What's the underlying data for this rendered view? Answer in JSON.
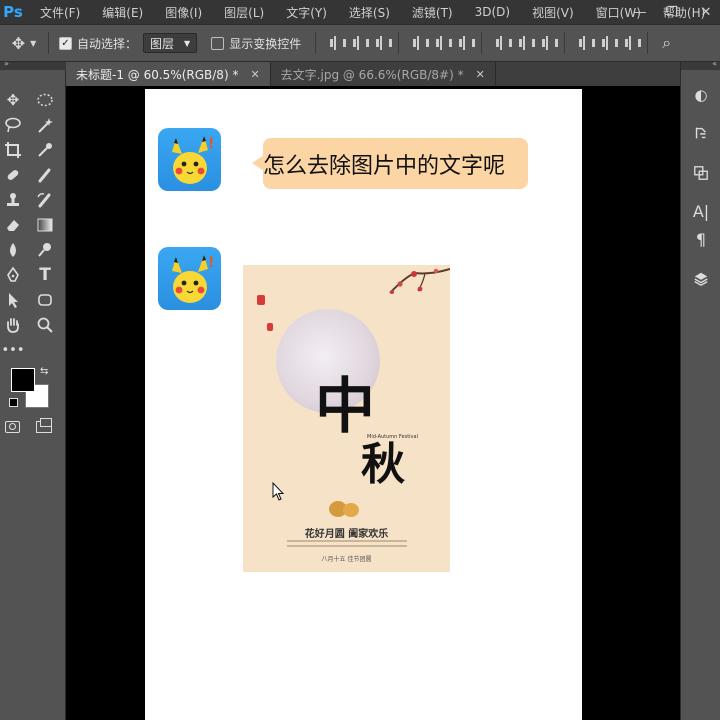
{
  "app": {
    "logo": "Ps",
    "menu": [
      "文件(F)",
      "编辑(E)",
      "图像(I)",
      "图层(L)",
      "文字(Y)",
      "选择(S)",
      "滤镜(T)",
      "3D(D)",
      "视图(V)",
      "窗口(W)",
      "帮助(H)"
    ]
  },
  "options": {
    "auto_select_label": "自动选择：",
    "auto_select_checked": true,
    "target_value": "图层",
    "show_transform_label": "显示变换控件",
    "show_transform_checked": false
  },
  "tabs": [
    {
      "label": "未标题-1 @ 60.5%(RGB/8) *",
      "active": true
    },
    {
      "label": "去文字.jpg @ 66.6%(RGB/8#) *",
      "active": false
    }
  ],
  "document": {
    "question": "怎么去除图片中的文字呢",
    "poster": {
      "title_main": "中",
      "title_sub": "秋",
      "english": "Mid-Autumn Festival",
      "motto": "花好月圆  阖家欢乐",
      "footer": "八月十五  佳节团圆"
    }
  },
  "colors": {
    "ps_blue": "#31a8ff",
    "bubble": "#fcd5a4",
    "avatar_bg": "#3aa7f2",
    "poster_bg": "#f6e3c7",
    "foreground": "#000000",
    "background": "#ffffff"
  }
}
